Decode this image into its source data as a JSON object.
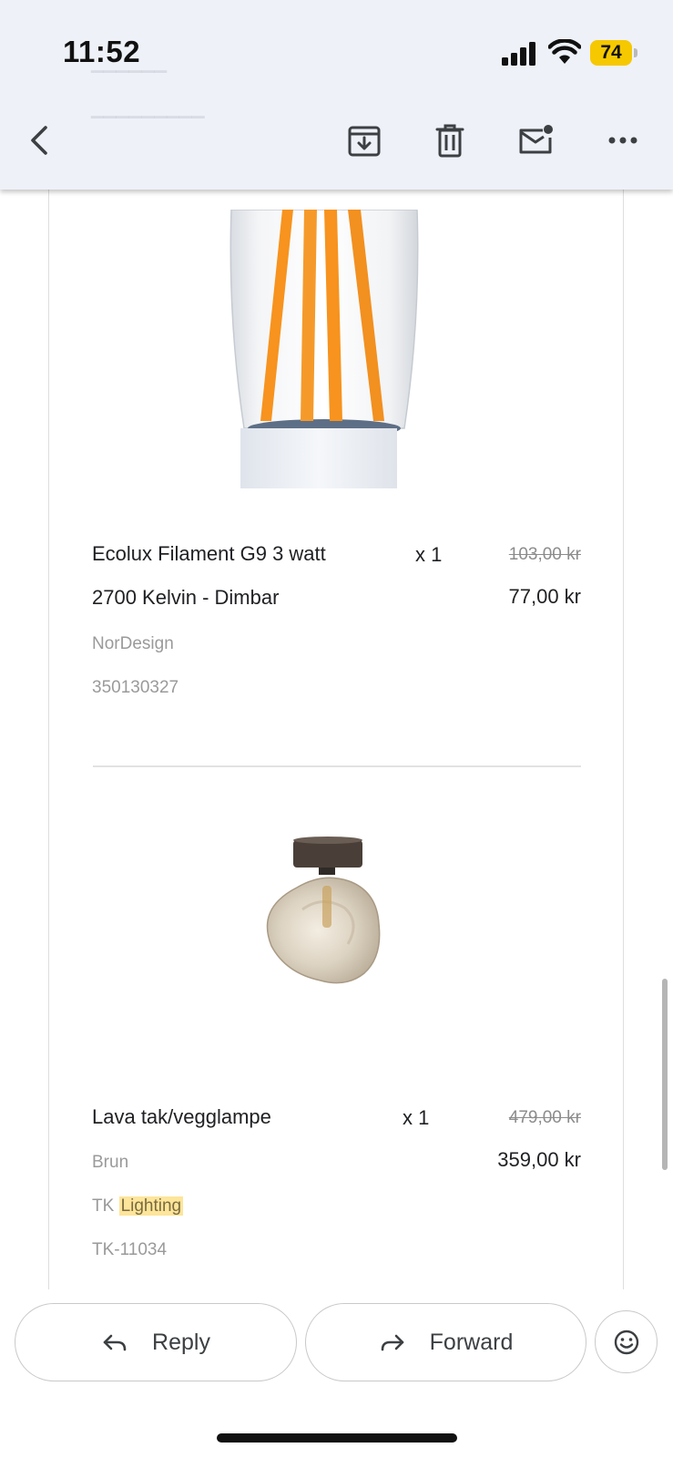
{
  "status_bar": {
    "time": "11:52",
    "battery": "74"
  },
  "toolbar": {
    "back_icon": "chevron-left-icon",
    "archive_icon": "archive-icon",
    "delete_icon": "trash-icon",
    "mark_unread_icon": "mark-unread-icon",
    "more_icon": "more-horizontal-icon"
  },
  "items": [
    {
      "name_line1": "Ecolux Filament G9 3 watt",
      "name_line2": "2700 Kelvin - Dimbar",
      "brand": "NorDesign",
      "sku": "350130327",
      "quantity": "x 1",
      "old_price": "103,00 kr",
      "price": "77,00 kr"
    },
    {
      "name_line1": "Lava tak/vegglampe",
      "variant": "Brun",
      "brand_prefix": "TK",
      "brand_highlight": "Lighting",
      "sku": "TK-11034",
      "quantity": "x 1",
      "old_price": "479,00 kr",
      "price": "359,00 kr"
    }
  ],
  "actions": {
    "reply_label": "Reply",
    "forward_label": "Forward",
    "emoji_icon": "smiley-icon"
  },
  "colors": {
    "toolbar_bg": "#eef1f7",
    "battery": "#f6c800",
    "highlight": "#fde59a",
    "filament": "#f7931e"
  }
}
